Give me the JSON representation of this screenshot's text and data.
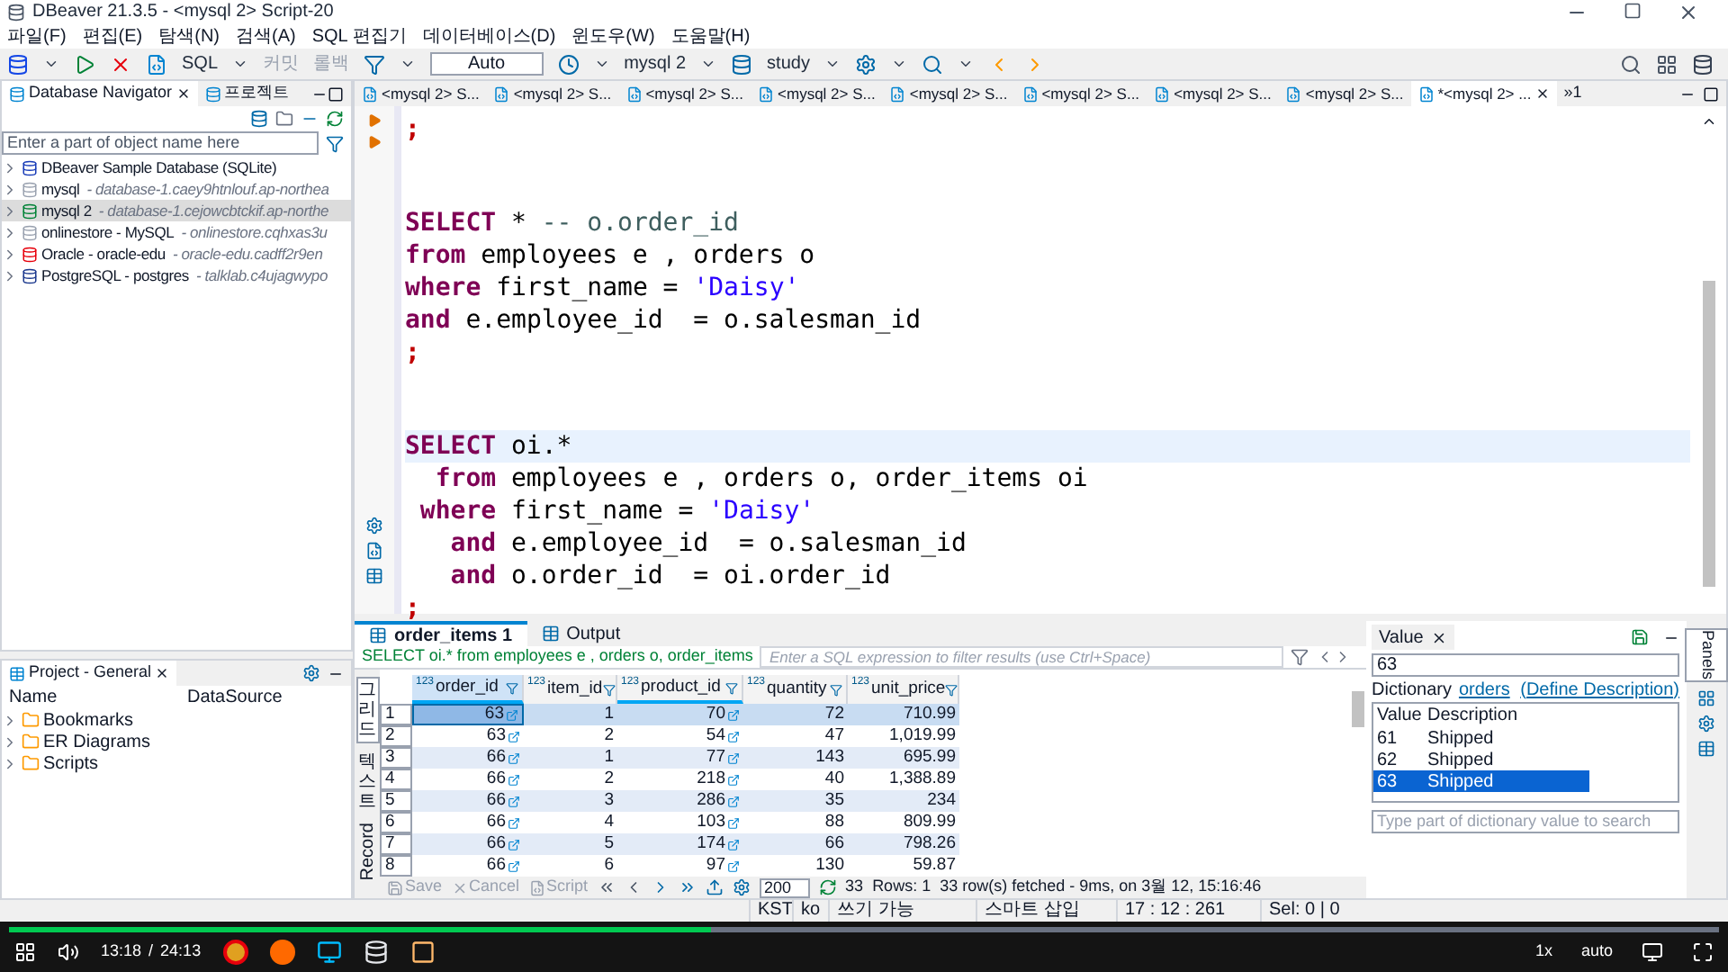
{
  "window": {
    "title": "DBeaver 21.3.5 - <mysql 2> Script-20"
  },
  "menu": [
    "파일(F)",
    "편집(E)",
    "탐색(N)",
    "검색(A)",
    "SQL 편집기",
    "데이터베이스(D)",
    "윈도우(W)",
    "도움말(H)"
  ],
  "toolbar": {
    "sql": "SQL",
    "commit": {
      "label": "커밋",
      "disabled": true
    },
    "rollback": {
      "label": "롤백",
      "disabled": true
    },
    "mode": "Auto",
    "connection": "mysql 2",
    "schema": "study"
  },
  "navigator": {
    "tabs": [
      {
        "label": "Database Navigator",
        "selected": true
      },
      {
        "label": "프로젝트",
        "selected": false
      }
    ],
    "search": {
      "placeholder": "Enter a part of object name here"
    },
    "items": [
      {
        "name": "DBeaver Sample Database (SQLite)",
        "selected": false,
        "kind": "sqlite"
      },
      {
        "name": "mysql",
        "detail": "- database-1.caey9htnlouf.ap-northea",
        "selected": false,
        "kind": "mysql"
      },
      {
        "name": "mysql 2",
        "detail": "- database-1.cejowcbtckif.ap-northe",
        "selected": true,
        "kind": "mysql-connected"
      },
      {
        "name": "onlinestore - MySQL",
        "detail": "- onlinestore.cqhxas3u",
        "selected": false,
        "kind": "mysql"
      },
      {
        "name": "Oracle - oracle-edu",
        "detail": "- oracle-edu.cadff2r9en",
        "selected": false,
        "kind": "oracle"
      },
      {
        "name": "PostgreSQL - postgres",
        "detail": "- talklab.c4ujagwypo",
        "selected": false,
        "kind": "postgres"
      }
    ]
  },
  "project": {
    "title": "Project - General",
    "columns": [
      "Name",
      "DataSource"
    ],
    "items": [
      "Bookmarks",
      "ER Diagrams",
      "Scripts"
    ]
  },
  "editor": {
    "tabs": [
      {
        "label": "<mysql 2> S...",
        "selected": false
      },
      {
        "label": "<mysql 2> S...",
        "selected": false
      },
      {
        "label": "<mysql 2> S...",
        "selected": false
      },
      {
        "label": "<mysql 2> S...",
        "selected": false
      },
      {
        "label": "<mysql 2> S...",
        "selected": false
      },
      {
        "label": "<mysql 2> S...",
        "selected": false
      },
      {
        "label": "<mysql 2> S...",
        "selected": false
      },
      {
        "label": "<mysql 2> S...",
        "selected": false
      },
      {
        "label": "*<mysql 2> ...",
        "selected": true
      }
    ],
    "more_tabs": "»1",
    "blocks": [
      {
        "lines": [
          {
            "current": false,
            "tokens": [
              {
                "kind": "punct",
                "text": ";"
              }
            ]
          }
        ]
      },
      {
        "lines": [
          {
            "current": false,
            "tokens": [
              {
                "kind": "keyword",
                "text": "SELECT"
              },
              {
                "kind": "plain",
                "text": " * "
              },
              {
                "kind": "comment",
                "text": "-- o.order_id"
              }
            ]
          },
          {
            "current": false,
            "tokens": [
              {
                "kind": "keyword",
                "text": "from"
              },
              {
                "kind": "plain",
                "text": " employees e , orders o"
              }
            ]
          },
          {
            "current": false,
            "tokens": [
              {
                "kind": "keyword",
                "text": "where"
              },
              {
                "kind": "plain",
                "text": " first_name = "
              },
              {
                "kind": "string",
                "text": "'Daisy'"
              }
            ]
          },
          {
            "current": false,
            "tokens": [
              {
                "kind": "keyword",
                "text": "and"
              },
              {
                "kind": "plain",
                "text": " e.employee_id  = o.salesman_id"
              }
            ]
          },
          {
            "current": false,
            "tokens": [
              {
                "kind": "punct",
                "text": ";"
              }
            ]
          }
        ]
      },
      {
        "lines": [
          {
            "current": true,
            "tokens": [
              {
                "kind": "keyword",
                "text": "SELECT"
              },
              {
                "kind": "plain",
                "text": " oi.*"
              }
            ]
          },
          {
            "current": false,
            "tokens": [
              {
                "kind": "keyword",
                "text": "  from"
              },
              {
                "kind": "plain",
                "text": " employees e , orders o, order_items oi"
              }
            ]
          },
          {
            "current": false,
            "tokens": [
              {
                "kind": "keyword",
                "text": " where"
              },
              {
                "kind": "plain",
                "text": " first_name = "
              },
              {
                "kind": "string",
                "text": "'Daisy'"
              }
            ]
          },
          {
            "current": false,
            "tokens": [
              {
                "kind": "keyword",
                "text": "   and"
              },
              {
                "kind": "plain",
                "text": " e.employee_id  = o.salesman_id"
              }
            ]
          },
          {
            "current": false,
            "tokens": [
              {
                "kind": "keyword",
                "text": "   and"
              },
              {
                "kind": "plain",
                "text": " o.order_id  = oi.order_id"
              }
            ]
          },
          {
            "current": false,
            "tokens": [
              {
                "kind": "punct",
                "text": ";"
              }
            ]
          }
        ]
      }
    ]
  },
  "results": {
    "tabs": [
      {
        "label": "order_items 1",
        "selected": true
      },
      {
        "label": "Output",
        "selected": false
      }
    ],
    "query": "SELECT oi.* from employees e , orders o, order_items",
    "filter": {
      "placeholder": "Enter a SQL expression to filter results (use Ctrl+Space)"
    },
    "view_tabs": [
      {
        "label": "그리드",
        "selected": true,
        "kind": "stack"
      },
      {
        "label": "텍스트",
        "selected": false,
        "kind": "stack"
      },
      {
        "label": "Record",
        "selected": false,
        "kind": "rotate"
      }
    ],
    "columns": [
      {
        "name": "order_id",
        "type": "123",
        "link": true
      },
      {
        "name": "item_id",
        "type": "123",
        "link": false
      },
      {
        "name": "product_id",
        "type": "123",
        "link": true
      },
      {
        "name": "quantity",
        "type": "123",
        "link": false
      },
      {
        "name": "unit_price",
        "type": "123",
        "link": false
      }
    ],
    "rows": [
      {
        "num": "1",
        "selected": true,
        "cells": [
          "63",
          "1",
          "70",
          "72",
          "710.99"
        ]
      },
      {
        "num": "2",
        "selected": false,
        "cells": [
          "63",
          "2",
          "54",
          "47",
          "1,019.99"
        ]
      },
      {
        "num": "3",
        "selected": false,
        "cells": [
          "66",
          "1",
          "77",
          "143",
          "695.99"
        ]
      },
      {
        "num": "4",
        "selected": false,
        "cells": [
          "66",
          "2",
          "218",
          "40",
          "1,388.89"
        ]
      },
      {
        "num": "5",
        "selected": false,
        "cells": [
          "66",
          "3",
          "286",
          "35",
          "234"
        ]
      },
      {
        "num": "6",
        "selected": false,
        "cells": [
          "66",
          "4",
          "103",
          "88",
          "809.99"
        ]
      },
      {
        "num": "7",
        "selected": false,
        "cells": [
          "66",
          "5",
          "174",
          "66",
          "798.26"
        ]
      },
      {
        "num": "8",
        "selected": false,
        "cells": [
          "66",
          "6",
          "97",
          "130",
          "59.87"
        ]
      }
    ],
    "footer": {
      "save": "Save",
      "cancel": "Cancel",
      "script": "Script",
      "fetch_size": "200",
      "count": "33",
      "rows": "Rows: 1",
      "message": "33 row(s) fetched - 9ms, on 3월 12, 15:16:46"
    }
  },
  "value_panel": {
    "title": "Value",
    "value": "63",
    "dictionary_label": "Dictionary",
    "dictionary_link": "orders",
    "define_link": "(Define Description)",
    "columns": [
      "Value",
      "Description"
    ],
    "rows": [
      {
        "value": "61",
        "description": "Shipped",
        "selected": false
      },
      {
        "value": "62",
        "description": "Shipped",
        "selected": false
      },
      {
        "value": "63",
        "description": "Shipped",
        "selected": true
      }
    ],
    "search": {
      "placeholder": "Type part of dictionary value to search"
    },
    "side_tab": "Panels"
  },
  "status_bar": [
    "KST",
    "ko",
    "쓰기 가능",
    "스마트 삽입",
    "17 : 12 : 261",
    "Sel: 0 | 0"
  ],
  "video_player": {
    "elapsed": "13:18",
    "separator": "/",
    "duration": "24:13",
    "level": 0.41,
    "speed": "1x",
    "quality": "auto"
  }
}
